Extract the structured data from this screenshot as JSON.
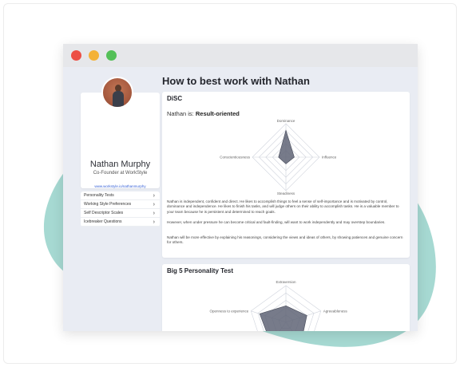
{
  "colors": {
    "blob": "#a6d9d2",
    "accent": "#3a64d8",
    "radar_fill": "#5f6475"
  },
  "window": {
    "buttons": [
      "close",
      "minimize",
      "maximize"
    ]
  },
  "profile": {
    "name": "Nathan Murphy",
    "role": "Co-Founder at WorkStyle",
    "link": "www.workstyle.io/nathanmurphy"
  },
  "menu": {
    "items": [
      {
        "label": "Personality Tests"
      },
      {
        "label": "Working Style Preferences"
      },
      {
        "label": "Self Descriptor Scales"
      },
      {
        "label": "Icebreaker Questions"
      }
    ]
  },
  "page": {
    "title": "How to best work with Nathan"
  },
  "disc": {
    "title": "DiSC",
    "result_prefix": "Nathan is:",
    "result": "Result-oriented",
    "axes": {
      "top": "Dominance",
      "right": "Influence",
      "bottom": "Steadiness",
      "left": "Conscientiousness"
    },
    "values": {
      "dominance": 0.8,
      "influence": 0.25,
      "steadiness": 0.2,
      "conscientiousness": 0.22
    },
    "paragraphs": [
      "Nathan is independent, confident and direct. He likes to accomplish things to feel a sense of self-importance and is motivated by control, dominance and independence. He likes to finish his tasks, and will judge others on their ability to accomplish tasks. He is a valuable member to your team because he is persistent and determined to reach goals.",
      "However, when under pressure he can become critical and fault-finding, will want to work independently and may overstep boundaries.",
      "Nathan will be more effective by explaining his reasonings, considering the views and ideas of others, by showing patiences and genuine concern for others."
    ]
  },
  "big5": {
    "title": "Big 5 Personality Test",
    "axes": {
      "top": "Extraversion",
      "right": "Agreeableness",
      "left": "Openness to experience"
    }
  }
}
